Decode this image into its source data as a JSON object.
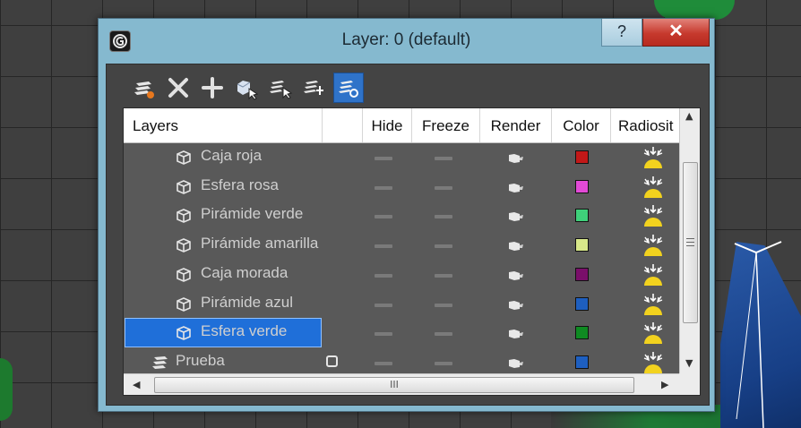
{
  "window": {
    "title": "Layer: 0 (default)",
    "help_label": "?",
    "close_label": "✕"
  },
  "toolbar": {
    "buttons": [
      {
        "name": "create-new-layer-button",
        "icon": "new-layer-icon"
      },
      {
        "name": "delete-layer-button",
        "icon": "close-icon"
      },
      {
        "name": "add-to-layer-button",
        "icon": "plus-icon"
      },
      {
        "name": "select-highlighted-objects-button",
        "icon": "select-objects-icon"
      },
      {
        "name": "highlight-selected-objects-button",
        "icon": "highlight-layers-icon"
      },
      {
        "name": "select-layer-button",
        "icon": "select-layer-icon"
      },
      {
        "name": "set-current-layer-button",
        "icon": "current-layer-icon",
        "active": true
      }
    ]
  },
  "table": {
    "columns": [
      "Layers",
      "Hide",
      "Freeze",
      "Render",
      "Color",
      "Radiosit"
    ],
    "rows": [
      {
        "name": "Caja roja",
        "color": "#c21818",
        "type": "object"
      },
      {
        "name": "Esfera rosa",
        "color": "#e24ad6",
        "type": "object"
      },
      {
        "name": "Pirámide verde",
        "color": "#3fd07a",
        "type": "object"
      },
      {
        "name": "Pirámide amarilla",
        "color": "#d8e88a",
        "type": "object"
      },
      {
        "name": "Caja morada",
        "color": "#7a0f6a",
        "type": "object"
      },
      {
        "name": "Pirámide azul",
        "color": "#1e5fc0",
        "type": "object"
      },
      {
        "name": "Esfera verde",
        "color": "#0f8a22",
        "type": "object",
        "selected": true
      },
      {
        "name": "Prueba",
        "color": "#1e5fc0",
        "type": "layer"
      }
    ],
    "scroll_thumb_label": "III"
  },
  "colors": {
    "selection": "#1f6fd9",
    "panel": "#444444",
    "titlebar": "#85b9cf",
    "close": "#c6392d"
  }
}
